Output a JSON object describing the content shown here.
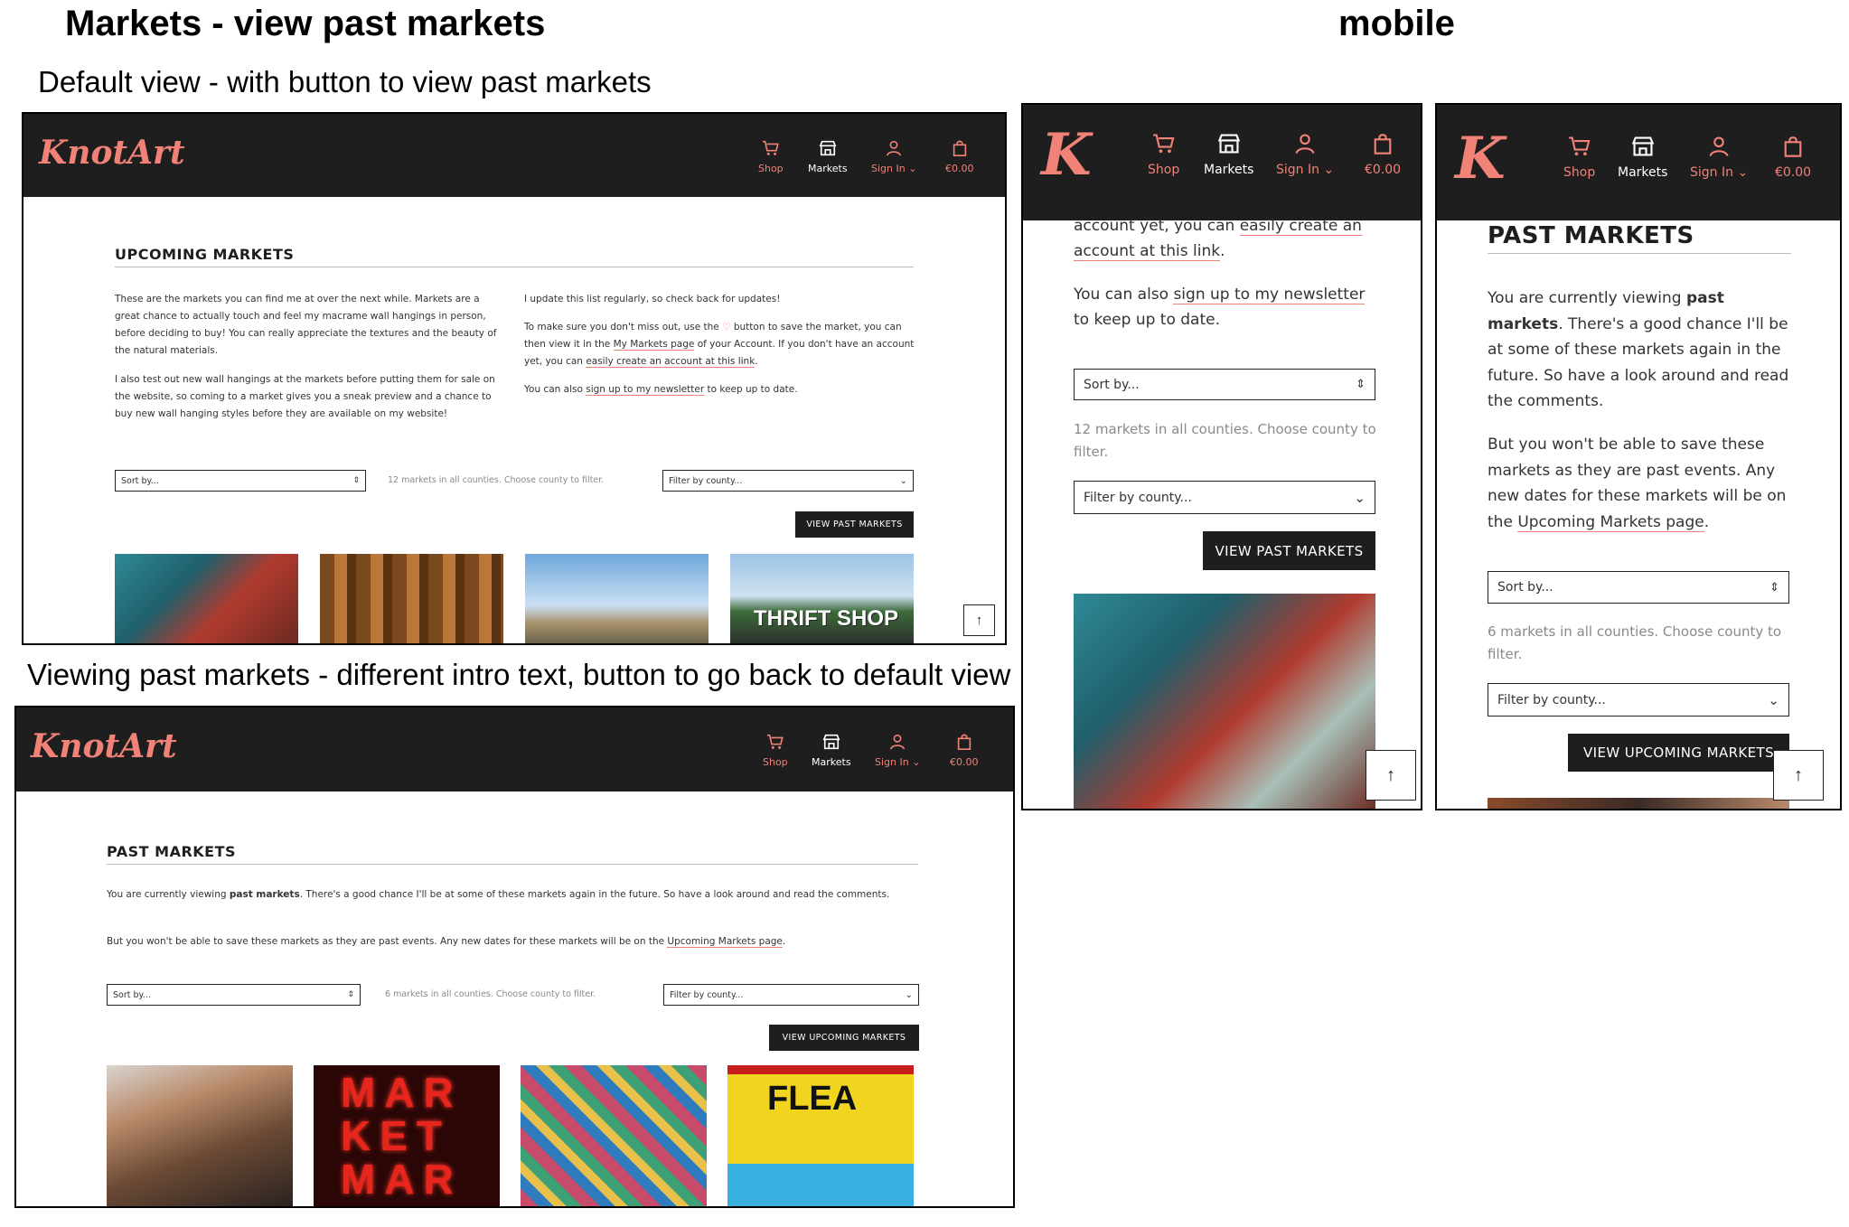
{
  "headings": {
    "desktop": "Markets - view past markets",
    "mobile": "mobile",
    "default_caption": "Default view - with button to view past markets",
    "past_caption": "Viewing past markets - different intro text, button to go back to default view"
  },
  "brand": {
    "logo_text": "KnotArt",
    "logo_short": "K",
    "accent_color": "#f08277",
    "header_color": "#1e1e1e"
  },
  "nav": {
    "shop": "Shop",
    "markets": "Markets",
    "sign_in": "Sign In",
    "cart": "€0.00",
    "icons": [
      "cart-icon",
      "market-stall-icon",
      "user-icon",
      "shopping-bag-icon"
    ]
  },
  "default_view": {
    "title": "UPCOMING MARKETS",
    "left_p1": "These are the markets you can find me at over the next while. Markets are a great chance to actually touch and feel my macrame wall hangings in person, before deciding to buy! You can really appreciate the textures and the beauty of the natural materials.",
    "left_p2": "I also test out new wall hangings at the markets before putting them for sale on the website, so coming to a market gives you a sneak preview and a chance to buy new wall hanging styles before they are available on my website!",
    "right_p1": "I update this list regularly, so check back for updates!",
    "right_p2_a": "To make sure you don't miss out, use the",
    "right_p2_b": "button to save the market, you can then view it in the",
    "right_p2_link1": "My Markets page",
    "right_p2_c": "of your Account. If you don't have an account yet, you can",
    "right_p2_link2": "easily create an account at this link",
    "right_p3_a": "You can also",
    "right_p3_link": "sign up to my newsletter",
    "right_p3_b": "to keep up to date.",
    "sort_placeholder": "Sort by...",
    "count_text": "12 markets in all counties. Choose county to filter.",
    "filter_placeholder": "Filter by county...",
    "button": "VIEW PAST MARKETS"
  },
  "past_view": {
    "title": "PAST MARKETS",
    "p1_a": "You are currently viewing",
    "p1_bold": "past markets",
    "p1_b": ". There's a good chance I'll be at some of these markets again in the future. So have a look around and read the comments.",
    "p2_a": "But you won't be able to save these markets as they are past events. Any new dates for these markets will be on the",
    "p2_link": "Upcoming Markets page",
    "p2_b": ".",
    "sort_placeholder": "Sort by...",
    "count_text": "6 markets in all counties. Choose county to filter.",
    "filter_placeholder": "Filter by county...",
    "button": "VIEW UPCOMING MARKETS"
  },
  "mobile_default": {
    "intro_a": "account yet, you can",
    "intro_link": "easily create an account at this link",
    "intro_b": ".",
    "news_a": "You can also",
    "news_link": "sign up to my newsletter",
    "news_b": "to keep up to date."
  },
  "back_to_top": "↑"
}
